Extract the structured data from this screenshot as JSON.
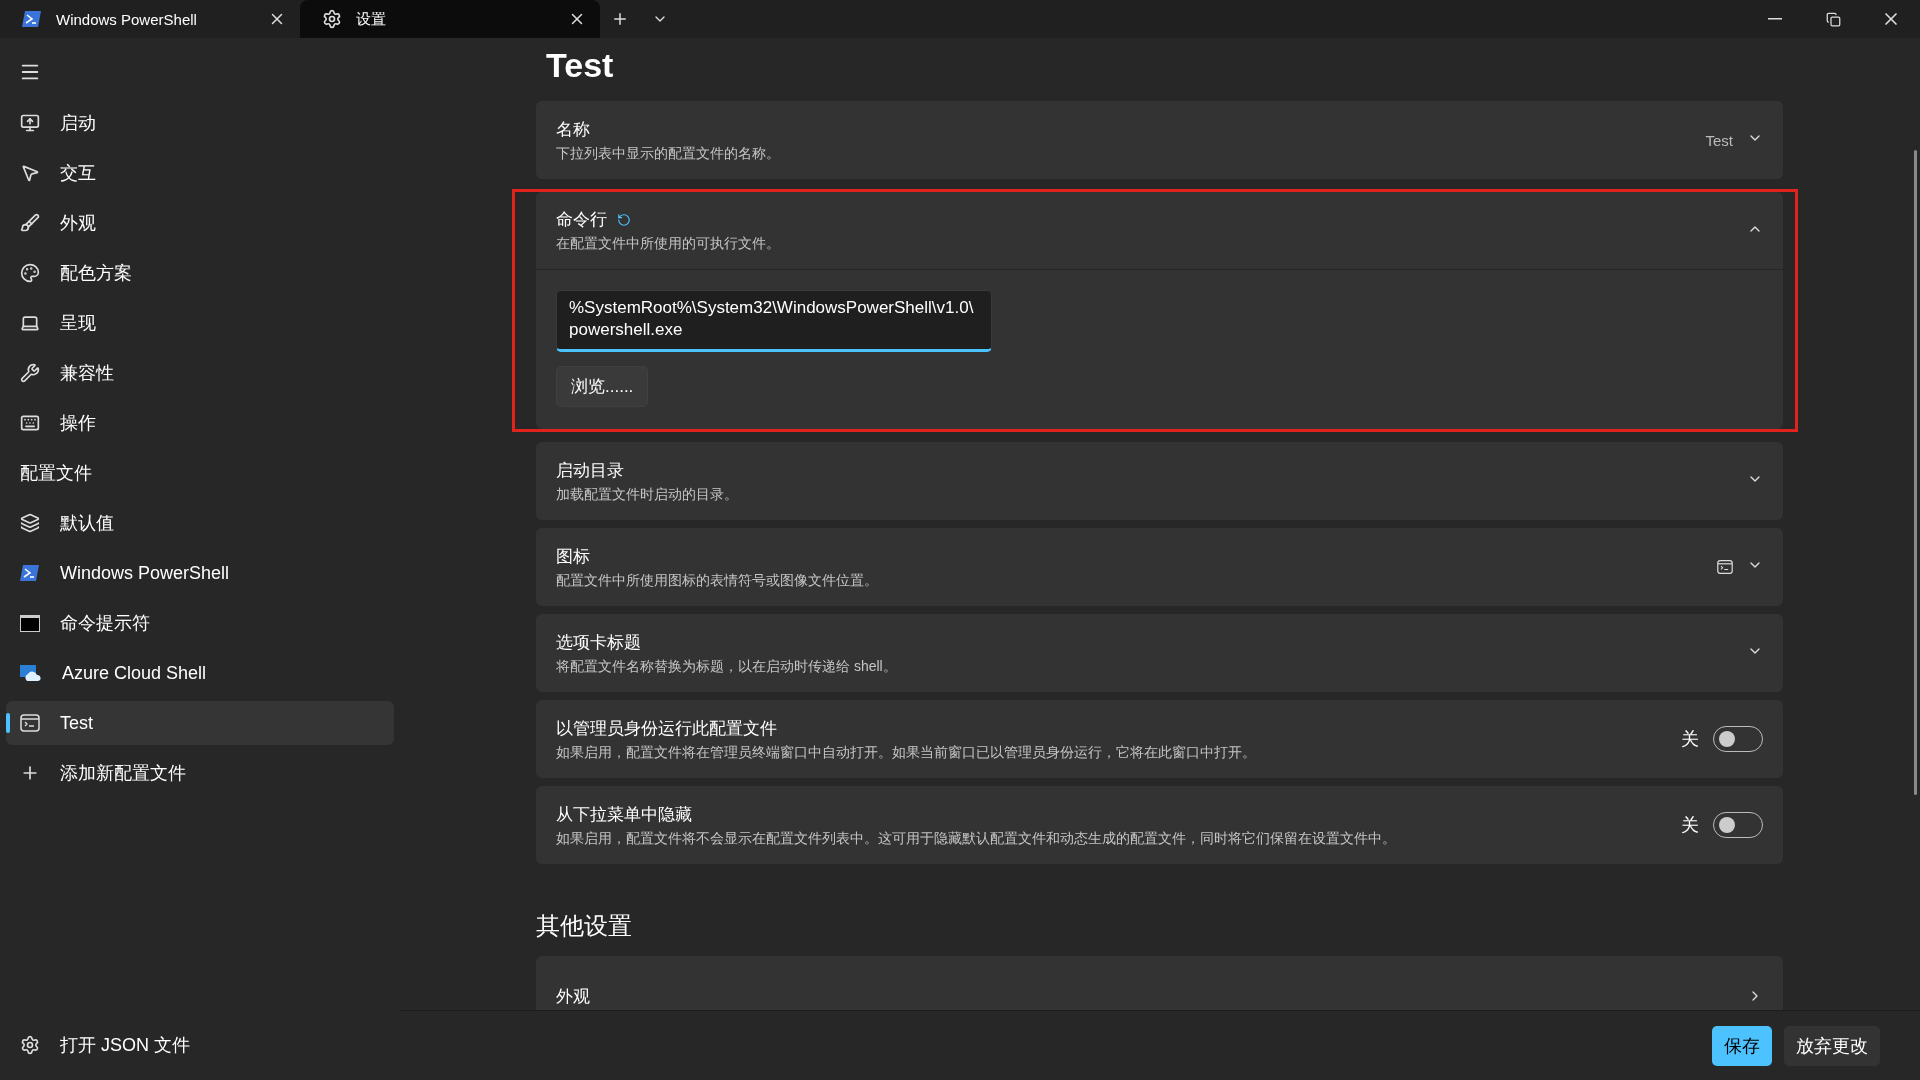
{
  "tabs": [
    {
      "title": "Windows PowerShell",
      "selected": false
    },
    {
      "title": "设置",
      "selected": true
    }
  ],
  "sidebar": {
    "items": [
      {
        "label": "启动",
        "selected": false
      },
      {
        "label": "交互",
        "selected": false
      },
      {
        "label": "外观",
        "selected": false
      },
      {
        "label": "配色方案",
        "selected": false
      },
      {
        "label": "呈现",
        "selected": false
      },
      {
        "label": "兼容性",
        "selected": false
      },
      {
        "label": "操作",
        "selected": false
      }
    ],
    "section_title": "配置文件",
    "profiles": [
      {
        "label": "默认值",
        "selected": false
      },
      {
        "label": "Windows PowerShell",
        "selected": false
      },
      {
        "label": "命令提示符",
        "selected": false
      },
      {
        "label": "Azure Cloud Shell",
        "selected": false
      },
      {
        "label": "Test",
        "selected": true
      }
    ],
    "add_label": "添加新配置文件",
    "footer_link": "打开 JSON 文件"
  },
  "page_title": "Test",
  "settings": [
    {
      "kind": "dropdown",
      "title": "名称",
      "description": "下拉列表中显示的配置文件的名称。",
      "value": "Test",
      "expanded": false,
      "modified": false,
      "highlighted": false
    },
    {
      "kind": "expander",
      "title": "命令行",
      "description": "在配置文件中所使用的可执行文件。",
      "expanded": true,
      "modified": true,
      "highlighted": true,
      "input_value": "%SystemRoot%\\System32\\WindowsPowerShell\\v1.0\\powershell.exe",
      "button": "浏览......"
    },
    {
      "kind": "expander",
      "title": "启动目录",
      "description": "加载配置文件时启动的目录。",
      "expanded": false,
      "modified": false,
      "highlighted": false
    },
    {
      "kind": "icon-picker",
      "title": "图标",
      "description": "配置文件中所使用图标的表情符号或图像文件位置。",
      "expanded": false,
      "modified": false,
      "highlighted": false
    },
    {
      "kind": "expander",
      "title": "选项卡标题",
      "description": "将配置文件名称替换为标题，以在启动时传递给 shell。",
      "expanded": false,
      "modified": false,
      "highlighted": false
    },
    {
      "kind": "toggle",
      "title": "以管理员身份运行此配置文件",
      "description": "如果启用，配置文件将在管理员终端窗口中自动打开。如果当前窗口已以管理员身份运行，它将在此窗口中打开。",
      "on": false,
      "state_label": "关",
      "modified": false,
      "highlighted": false
    },
    {
      "kind": "toggle",
      "title": "从下拉菜单中隐藏",
      "description": "如果启用，配置文件将不会显示在配置文件列表中。这可用于隐藏默认配置文件和动态生成的配置文件，同时将它们保留在设置文件中。",
      "on": false,
      "state_label": "关",
      "modified": false,
      "highlighted": false
    }
  ],
  "other_title": "其他设置",
  "other_items": [
    {
      "title": "外观"
    }
  ],
  "footer_buttons": [
    {
      "label": "保存",
      "kind": "primary"
    },
    {
      "label": "放弃更改",
      "kind": "secondary"
    }
  ]
}
